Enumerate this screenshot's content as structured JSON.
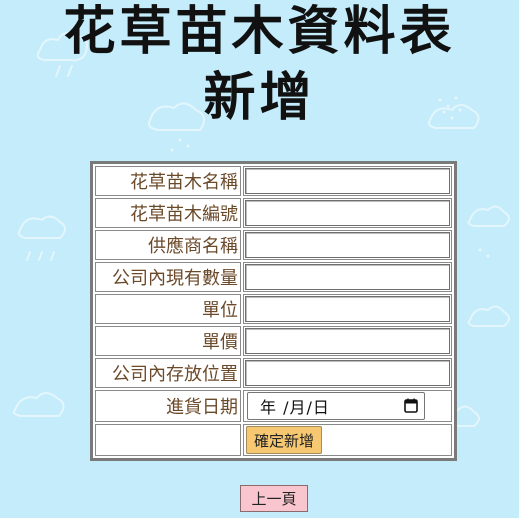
{
  "page": {
    "title_line1": "花草苗木資料表",
    "title_line2": "新增"
  },
  "form": {
    "rows": [
      {
        "label": "花草苗木名稱",
        "value": ""
      },
      {
        "label": "花草苗木編號",
        "value": ""
      },
      {
        "label": "供應商名稱",
        "value": ""
      },
      {
        "label": "公司內現有數量",
        "value": ""
      },
      {
        "label": "單位",
        "value": ""
      },
      {
        "label": "單價",
        "value": ""
      },
      {
        "label": "公司內存放位置",
        "value": ""
      }
    ],
    "date_row": {
      "label": "進貨日期",
      "display": "年 /月/日",
      "icon": "calendar-icon"
    },
    "submit_label": "確定新增"
  },
  "nav": {
    "back_label": "上一頁"
  },
  "colors": {
    "background": "#c4ecfb",
    "label_text": "#6b4a2a",
    "submit_bg": "#f7c872",
    "back_bg": "#f9c6cf"
  }
}
